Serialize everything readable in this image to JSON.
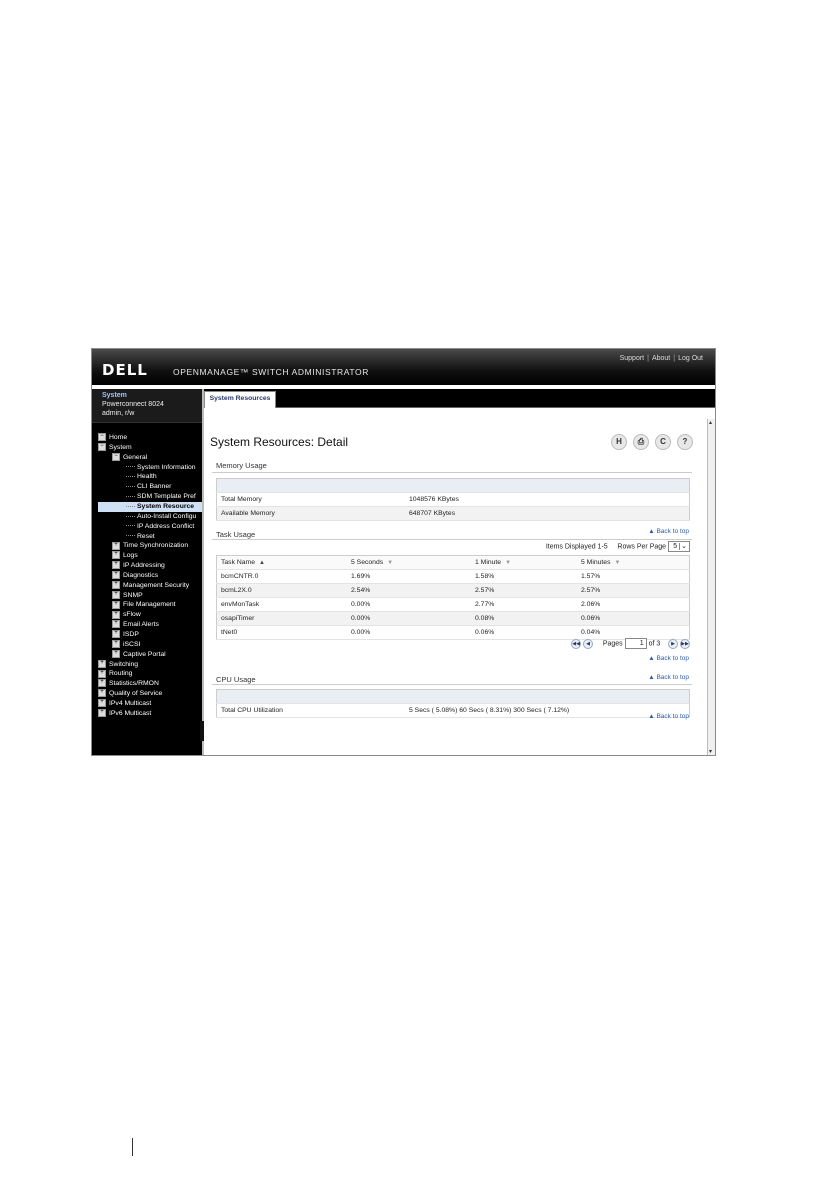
{
  "app": {
    "logo": "DELL",
    "product": "OPENMANAGE™ SWITCH ADMINISTRATOR",
    "links": [
      "Support",
      "About",
      "Log Out"
    ]
  },
  "device": {
    "title": "System",
    "model": "Powerconnect 8024",
    "user": "admin, r/w"
  },
  "tree": [
    {
      "label": "Home",
      "level": 0,
      "icon": "minus"
    },
    {
      "label": "System",
      "level": 0,
      "icon": "minus"
    },
    {
      "label": "General",
      "level": 1,
      "icon": "minus"
    },
    {
      "label": "System Information",
      "level": 2
    },
    {
      "label": "Health",
      "level": 2
    },
    {
      "label": "CLI Banner",
      "level": 2
    },
    {
      "label": "SDM Template Pref",
      "level": 2
    },
    {
      "label": "System Resource",
      "level": 2,
      "selected": true
    },
    {
      "label": "Auto-Install Configu",
      "level": 2
    },
    {
      "label": "IP Address Conflict",
      "level": 2
    },
    {
      "label": "Reset",
      "level": 2
    },
    {
      "label": "Time Synchronization",
      "level": 1,
      "icon": "plus"
    },
    {
      "label": "Logs",
      "level": 1,
      "icon": "plus"
    },
    {
      "label": "IP Addressing",
      "level": 1,
      "icon": "plus"
    },
    {
      "label": "Diagnostics",
      "level": 1,
      "icon": "plus"
    },
    {
      "label": "Management Security",
      "level": 1,
      "icon": "plus"
    },
    {
      "label": "SNMP",
      "level": 1,
      "icon": "plus"
    },
    {
      "label": "File Management",
      "level": 1,
      "icon": "plus"
    },
    {
      "label": "sFlow",
      "level": 1,
      "icon": "plus"
    },
    {
      "label": "Email Alerts",
      "level": 1,
      "icon": "plus"
    },
    {
      "label": "ISDP",
      "level": 1,
      "icon": "plus"
    },
    {
      "label": "iSCSI",
      "level": 1,
      "icon": "plus"
    },
    {
      "label": "Captive Portal",
      "level": 1,
      "icon": "plus"
    },
    {
      "label": "Switching",
      "level": 0,
      "icon": "plus"
    },
    {
      "label": "Routing",
      "level": 0,
      "icon": "plus"
    },
    {
      "label": "Statistics/RMON",
      "level": 0,
      "icon": "plus"
    },
    {
      "label": "Quality of Service",
      "level": 0,
      "icon": "plus"
    },
    {
      "label": "IPv4 Multicast",
      "level": 0,
      "icon": "plus"
    },
    {
      "label": "IPv6 Multicast",
      "level": 0,
      "icon": "plus"
    }
  ],
  "tab": "System Resources",
  "page_title": "System Resources: Detail",
  "toolbar_icons": [
    "save-icon",
    "print-icon",
    "refresh-icon",
    "help-icon"
  ],
  "toolbar_glyphs": [
    "H",
    "⎙",
    "C",
    "?"
  ],
  "memory": {
    "heading": "Memory Usage",
    "rows": [
      {
        "label": "Total Memory",
        "value": "1048576  KBytes"
      },
      {
        "label": "Available Memory",
        "value": "648707  KBytes"
      }
    ]
  },
  "task": {
    "heading": "Task Usage",
    "back_to_top": "Back to top",
    "items_displayed": "Items Displayed 1-5",
    "rows_per_page_label": "Rows Per Page",
    "rows_per_page_value": "5",
    "columns": [
      "Task Name",
      "5 Seconds",
      "1 Minute",
      "5 Minutes"
    ],
    "rows": [
      [
        "bcmCNTR.0",
        "1.69%",
        "1.58%",
        "1.57%"
      ],
      [
        "bcmL2X.0",
        "2.54%",
        "2.57%",
        "2.57%"
      ],
      [
        "envMonTask",
        "0.00%",
        "2.77%",
        "2.06%"
      ],
      [
        "osapiTimer",
        "0.00%",
        "0.08%",
        "0.06%"
      ],
      [
        "tNet0",
        "0.00%",
        "0.06%",
        "0.04%"
      ]
    ],
    "pages_label": "Pages",
    "page_value": "1",
    "of_label": "of 3"
  },
  "cpu": {
    "heading": "CPU Usage",
    "back_to_top": "Back to top",
    "rows": [
      {
        "label": "Total CPU Utilization",
        "value": "5 Secs ( 5.08%) 60 Secs ( 8.31%) 300 Secs ( 7.12%)"
      }
    ]
  },
  "back_to_top": "Back to top",
  "colors": {
    "accent": "#2a5db0",
    "header": "#000000",
    "selected": "#cfe0f5"
  }
}
